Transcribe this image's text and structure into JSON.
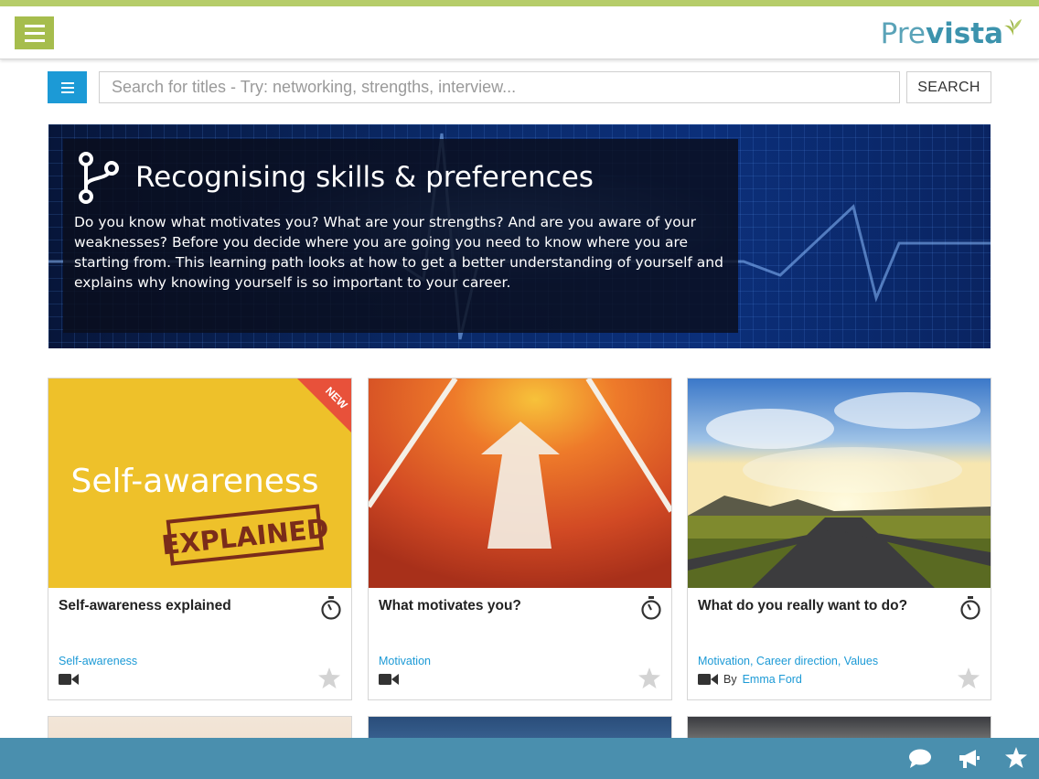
{
  "brand": {
    "logo_pre": "Pre",
    "logo_vista": "vista"
  },
  "search": {
    "placeholder": "Search for titles - Try: networking, strengths, interview...",
    "button_label": "SEARCH"
  },
  "hero": {
    "title": "Recognising skills & preferences",
    "description": "Do you know what motivates you? What are your strengths? And are you aware of your weaknesses? Before you decide where you are going you need to know where you are starting from. This learning path looks at how to get a better understanding of yourself and explains why knowing yourself is so important to your career."
  },
  "cards": [
    {
      "title": "Self-awareness explained",
      "image_text": "Self-awareness",
      "image_stamp": "EXPLAINED",
      "ribbon": "NEW",
      "tags": "Self-awareness",
      "media": "video-icon",
      "author_prefix": "",
      "author": ""
    },
    {
      "title": "What motivates you?",
      "tags": "Motivation",
      "media": "video-icon",
      "author_prefix": "",
      "author": ""
    },
    {
      "title": "What do you really want to do?",
      "tags": "Motivation, Career direction, Values",
      "media": "video-icon",
      "author_prefix": "By",
      "author": "Emma Ford"
    }
  ],
  "colors": {
    "accent_green": "#a6bd4d",
    "accent_blue": "#1c9ad6",
    "footer": "#4a8fae"
  },
  "footer_icons": [
    "chat-icon",
    "megaphone-icon",
    "star-icon"
  ]
}
